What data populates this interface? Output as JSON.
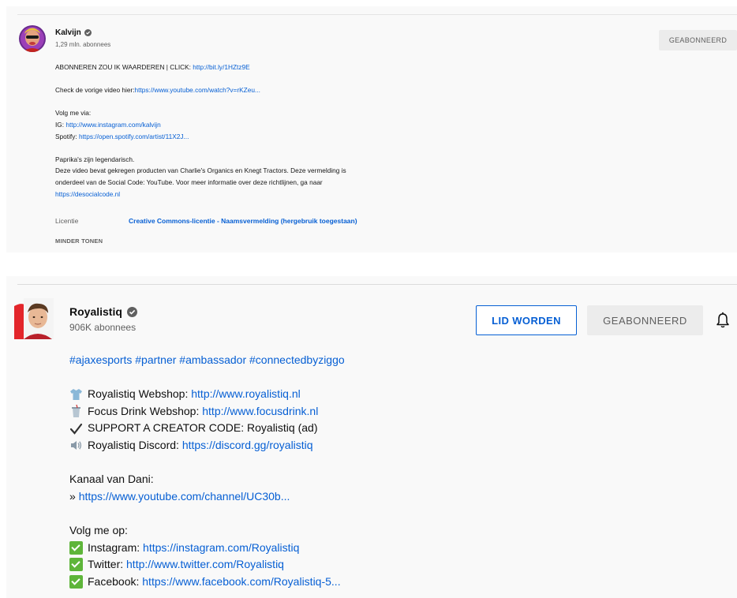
{
  "panel1": {
    "channel": {
      "name": "Kalvijn",
      "subscribers": "1,29 mln. abonnees"
    },
    "subscribe_button": "GEABONNEERD",
    "description": [
      {
        "text": "ABONNEREN ZOU IK WAARDEREN | CLICK: ",
        "link": "http://bit.ly/1HZtz9E"
      },
      {
        "blank": true
      },
      {
        "text": "Check de vorige video hier:",
        "link": "https://www.youtube.com/watch?v=rKZeu..."
      },
      {
        "blank": true
      },
      {
        "text": "Volg me via:",
        "link": ""
      },
      {
        "text": "IG: ",
        "link": "http://www.instagram.com/kalvijn"
      },
      {
        "text": "Spotify: ",
        "link": "https://open.spotify.com/artist/11X2J..."
      },
      {
        "blank": true
      },
      {
        "text": "Paprika's zijn legendarisch.",
        "link": ""
      },
      {
        "text": "Deze video bevat gekregen producten van Charlie's Organics en Knegt Tractors. Deze vermelding is",
        "link": ""
      },
      {
        "text": "onderdeel van de Social Code: YouTube. Voor meer informatie over deze richtlijnen, ga naar",
        "link": ""
      },
      {
        "text": "",
        "link": "https://desocialcode.nl"
      }
    ],
    "license_label": "Licentie",
    "license_value": "Creative Commons-licentie - Naamsvermelding (hergebruik toegestaan)",
    "show_less": "MINDER TONEN"
  },
  "panel2": {
    "channel": {
      "name": "Royalistiq",
      "subscribers": "906K abonnees"
    },
    "member_button": "LID WORDEN",
    "subscribe_button": "GEABONNEERD",
    "description": [
      {
        "text": "",
        "link": "#ajaxesports #partner #ambassador #connectedbyziggo"
      },
      {
        "blank": true
      },
      {
        "icon": "tshirt-icon",
        "text": "Royalistiq Webshop: ",
        "link": "http://www.royalistiq.nl"
      },
      {
        "icon": "drink-cup-icon",
        "text": "Focus Drink Webshop: ",
        "link": "http://www.focusdrink.nl"
      },
      {
        "icon": "checkmark-icon",
        "text": "SUPPORT A CREATOR CODE: Royalistiq (ad)",
        "link": ""
      },
      {
        "icon": "speaker-icon",
        "text": "Royalistiq Discord: ",
        "link": "https://discord.gg/royalistiq"
      },
      {
        "blank": true
      },
      {
        "text": "Kanaal van Dani:",
        "link": ""
      },
      {
        "text": "» ",
        "link": "https://www.youtube.com/channel/UC30b..."
      },
      {
        "blank": true
      },
      {
        "text": "Volg me op:",
        "link": ""
      },
      {
        "icon": "check-box-icon",
        "text": "Instagram: ",
        "link": "https://instagram.com/Royalistiq"
      },
      {
        "icon": "check-box-icon",
        "text": "Twitter: ",
        "link": "http://www.twitter.com/Royalistiq"
      },
      {
        "icon": "check-box-icon",
        "text": "Facebook: ",
        "link": "https://www.facebook.com/Royalistiq-5..."
      }
    ]
  }
}
